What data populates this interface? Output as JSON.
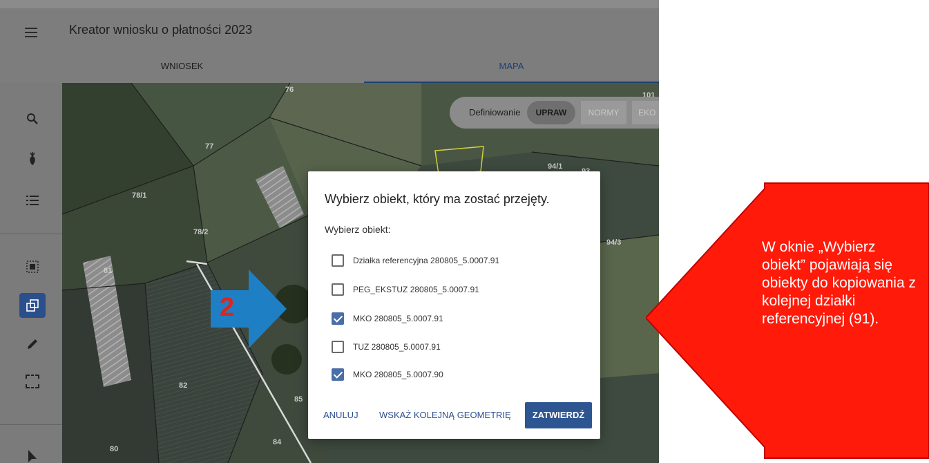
{
  "header": {
    "title": "Kreator wniosku o płatności 2023",
    "menu_icon": "hamburger-icon"
  },
  "tabs": [
    {
      "label": "WNIOSEK",
      "active": false
    },
    {
      "label": "MAPA",
      "active": true
    }
  ],
  "toolbar": {
    "items": [
      {
        "icon": "search-icon",
        "active": false
      },
      {
        "icon": "crop-icon",
        "active": false
      },
      {
        "icon": "list-icon",
        "active": false
      },
      {
        "icon": "select-area-icon",
        "active": false
      },
      {
        "icon": "copy-geometry-icon",
        "active": true
      },
      {
        "icon": "pencil-icon",
        "active": false
      },
      {
        "icon": "rectangle-selection-icon",
        "active": false
      },
      {
        "icon": "cursor-icon",
        "active": false
      }
    ]
  },
  "map": {
    "parcels": [
      "76",
      "77",
      "78/1",
      "78/2",
      "81",
      "82",
      "80",
      "84",
      "85",
      "94/1",
      "93",
      "94/3",
      "101"
    ],
    "definition": {
      "label": "Definiowanie",
      "chips": [
        "UPRAW",
        "NORMY",
        "EKO"
      ],
      "active_chip": "UPRAW"
    }
  },
  "dialog": {
    "title": "Wybierz obiekt, który ma zostać przejęty.",
    "subtitle": "Wybierz obiekt:",
    "options": [
      {
        "label": "Działka referencyjna 280805_5.0007.91",
        "checked": false
      },
      {
        "label": "PEG_EKSTUZ 280805_5.0007.91",
        "checked": false
      },
      {
        "label": "MKO 280805_5.0007.91",
        "checked": true
      },
      {
        "label": "TUZ 280805_5.0007.91",
        "checked": false
      },
      {
        "label": "MKO 280805_5.0007.90",
        "checked": true
      }
    ],
    "buttons": {
      "cancel": "ANULUJ",
      "next_geometry": "WSKAŻ KOLEJNĄ GEOMETRIĘ",
      "confirm": "ZATWIERDŹ"
    }
  },
  "annotation": {
    "step_number": "2",
    "callout_text": "W oknie „Wybierz obiekt” pojawiają się obiekty do kopiowania z kolejnej działki referencyjnej (91).",
    "colors": {
      "callout": "#ff1a0a",
      "callout_border": "#c00000",
      "step_arrow": "#1e7fc4",
      "step_number": "#e2231a"
    }
  }
}
